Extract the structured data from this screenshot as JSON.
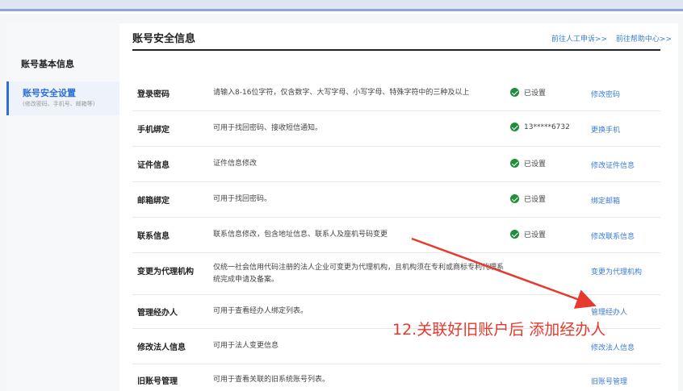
{
  "sidebar": {
    "basic_info": "账号基本信息",
    "active_title": "账号安全设置",
    "active_subtitle": "(修改密码、手机号、邮箱等)"
  },
  "header": {
    "title": "账号安全信息",
    "link_appeal": "前往人工申诉>>",
    "link_help": "前往帮助中心>>"
  },
  "rows": [
    {
      "name": "登录密码",
      "desc": "请输入8-16位字符，仅含数字、大写字母、小写字母、特殊字符中的三种及以上",
      "status": "已设置",
      "action": "修改密码"
    },
    {
      "name": "手机绑定",
      "desc": "可用于找回密码、接收短信通知。",
      "status": "13*****6732",
      "action": "更换手机"
    },
    {
      "name": "证件信息",
      "desc": "证件信息修改",
      "status": "已设置",
      "action": "修改证件信息"
    },
    {
      "name": "邮箱绑定",
      "desc": "可用于找回密码。",
      "status": "已设置",
      "action": "绑定邮箱"
    },
    {
      "name": "联系信息",
      "desc": "联系信息修改，包含地址信息、联系人及座机号码变更",
      "status": "已设置",
      "action": "修改联系信息"
    },
    {
      "name": "变更为代理机构",
      "desc": "仅统一社会信用代码注册的法人企业可变更为代理机构，且机构须在专利或商标专利代理系统完成申请及备案。",
      "status": "",
      "action": "变更为代理机构"
    },
    {
      "name": "管理经办人",
      "desc": "可用于查看经办人绑定列表。",
      "status": "",
      "action": "管理经办人"
    },
    {
      "name": "修改法人信息",
      "desc": "可用于法人变更信息",
      "status": "",
      "action": "修改法人信息"
    },
    {
      "name": "旧账号管理",
      "desc": "可用于查看关联的旧系统账号列表。",
      "status": "",
      "action": "旧账号管理"
    }
  ],
  "annotation": {
    "text": "12.关联好旧账户后 添加经办人",
    "color": "#e63a2e"
  },
  "colors": {
    "accent": "#2f6fd6",
    "link": "#3a7bd5",
    "check": "#1f8f3a"
  }
}
